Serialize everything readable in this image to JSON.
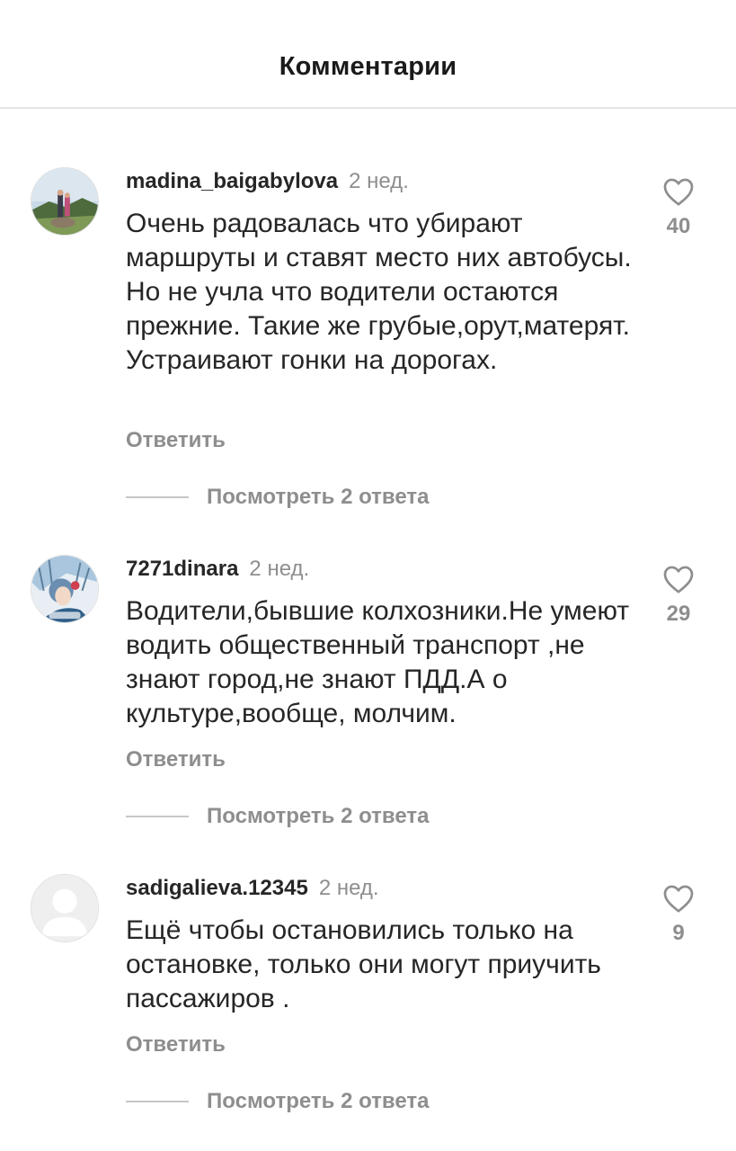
{
  "header": {
    "title": "Комментарии"
  },
  "comments": [
    {
      "username": "madina_baigabylova",
      "time": "2 нед.",
      "text": "Очень радовалась что убирают маршруты и ставят место них автобусы. Но не учла что водители остаются прежние. Такие же грубые,орут,матерят. Устраивают гонки на дорогах.",
      "reply_label": "Ответить",
      "view_replies_label": "Посмотреть 2 ответа",
      "likes": "40",
      "avatar_icon": "landscape-photo-avatar"
    },
    {
      "username": "7271dinara",
      "time": "2 нед.",
      "text": "Водители,бывшие колхозники.Не умеют водить общественный транспорт ,не знают город,не знают ПДД.А о культуре,вообще, молчим.",
      "reply_label": "Ответить",
      "view_replies_label": "Посмотреть 2 ответа",
      "likes": "29",
      "avatar_icon": "illustration-avatar"
    },
    {
      "username": "sadigalieva.12345",
      "time": "2 нед.",
      "text": "Ещё чтобы остановились только на остановке, только они могут приучить пассажиров .",
      "reply_label": "Ответить",
      "view_replies_label": "Посмотреть 2 ответа",
      "likes": "9",
      "avatar_icon": "default-user-avatar"
    }
  ],
  "colors": {
    "text": "#262626",
    "secondary": "#8e8e8e",
    "divider": "#e6e6e6"
  }
}
